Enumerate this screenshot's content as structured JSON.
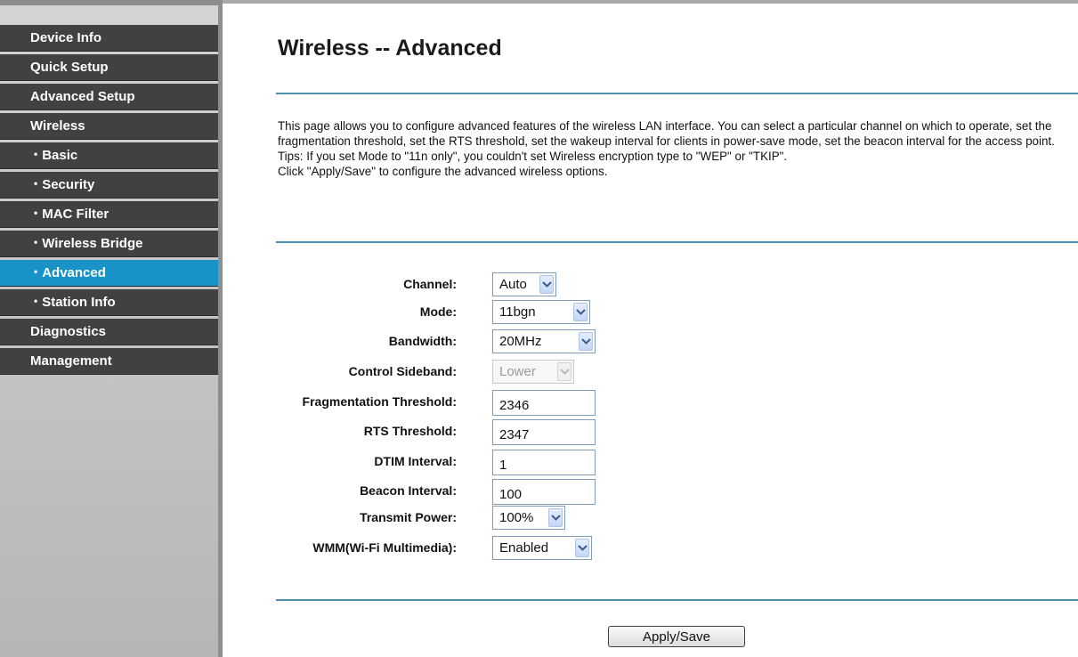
{
  "sidebar": {
    "items": [
      {
        "label": "Device Info",
        "sub": false,
        "active": false
      },
      {
        "label": "Quick Setup",
        "sub": false,
        "active": false
      },
      {
        "label": "Advanced Setup",
        "sub": false,
        "active": false
      },
      {
        "label": "Wireless",
        "sub": false,
        "active": false
      },
      {
        "label": "Basic",
        "sub": true,
        "active": false
      },
      {
        "label": "Security",
        "sub": true,
        "active": false
      },
      {
        "label": "MAC Filter",
        "sub": true,
        "active": false
      },
      {
        "label": "Wireless Bridge",
        "sub": true,
        "active": false
      },
      {
        "label": "Advanced",
        "sub": true,
        "active": true
      },
      {
        "label": "Station Info",
        "sub": true,
        "active": false
      },
      {
        "label": "Diagnostics",
        "sub": false,
        "active": false
      },
      {
        "label": "Management",
        "sub": false,
        "active": false
      }
    ],
    "bullet": "•"
  },
  "main": {
    "title": "Wireless -- Advanced",
    "description": [
      "This page allows you to configure advanced features of the wireless LAN interface. You can select a particular channel on which to operate, set the fragmentation threshold, set the RTS threshold, set the wakeup interval for clients in power-save mode, set the beacon interval for the access point.",
      "Tips: If you set Mode to \"11n only\", you couldn't set Wireless encryption type to \"WEP\" or \"TKIP\".",
      "Click \"Apply/Save\" to configure the advanced wireless options."
    ],
    "form": {
      "channel": {
        "label": "Channel:",
        "value": "Auto"
      },
      "mode": {
        "label": "Mode:",
        "value": "11bgn"
      },
      "bandwidth": {
        "label": "Bandwidth:",
        "value": "20MHz"
      },
      "control_sideband": {
        "label": "Control Sideband:",
        "value": "Lower",
        "disabled": true
      },
      "fragmentation_threshold": {
        "label": "Fragmentation Threshold:",
        "value": "2346"
      },
      "rts_threshold": {
        "label": "RTS Threshold:",
        "value": "2347"
      },
      "dtim_interval": {
        "label": "DTIM Interval:",
        "value": "1"
      },
      "beacon_interval": {
        "label": "Beacon Interval:",
        "value": "100"
      },
      "transmit_power": {
        "label": "Transmit Power:",
        "value": "100%"
      },
      "wmm": {
        "label": "WMM(Wi-Fi Multimedia):",
        "value": "Enabled"
      }
    },
    "apply_save_label": "Apply/Save"
  },
  "colors": {
    "nav_bg": "#414141",
    "nav_active": "#1992c8",
    "rule": "#4f8fb4"
  }
}
